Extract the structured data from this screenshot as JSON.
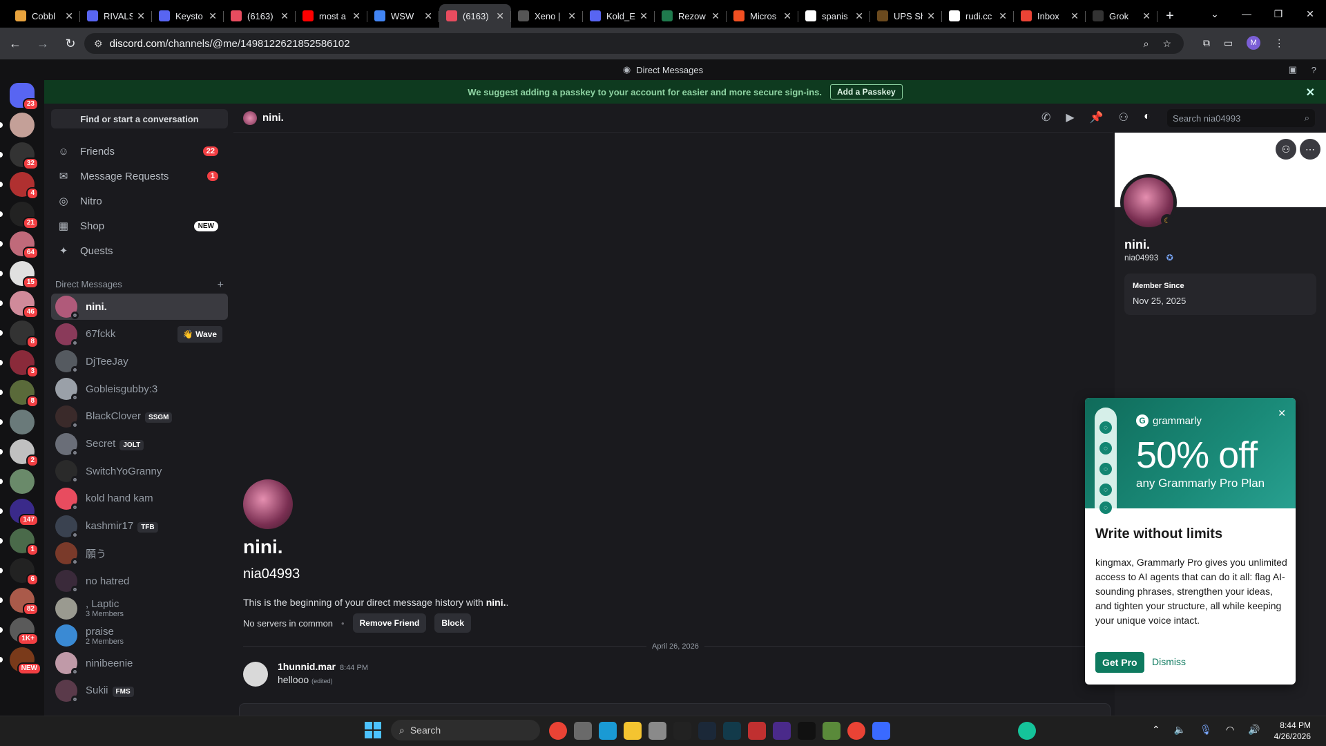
{
  "browser": {
    "tabs": [
      {
        "title": "Cobbl",
        "favcolor": "#e8a33d",
        "icon": "cobble-icon"
      },
      {
        "title": "RIVALS",
        "favcolor": "#5865f2",
        "icon": "discord-icon"
      },
      {
        "title": "Keysto",
        "favcolor": "#5865f2",
        "icon": "discord-icon"
      },
      {
        "title": "(6163)",
        "favcolor": "#e84c5f",
        "icon": "discord-icon"
      },
      {
        "title": "most a",
        "favcolor": "#ff0000",
        "icon": "youtube-icon"
      },
      {
        "title": "WSW",
        "favcolor": "#4285f4",
        "icon": "docs-icon"
      },
      {
        "title": "(6163)",
        "favcolor": "#e84c5f",
        "icon": "discord-icon"
      },
      {
        "title": "Xeno |",
        "favcolor": "#555555",
        "icon": "xeno-icon"
      },
      {
        "title": "Kold_E",
        "favcolor": "#5865f2",
        "icon": "discord-icon"
      },
      {
        "title": "Rezow",
        "favcolor": "#1f7a4d",
        "icon": "rezow-icon"
      },
      {
        "title": "Micros",
        "favcolor": "#f25022",
        "icon": "microsoft-icon"
      },
      {
        "title": "spanis",
        "favcolor": "#ffffff",
        "icon": "google-icon"
      },
      {
        "title": "UPS Sh",
        "favcolor": "#6b4a1e",
        "icon": "ups-icon"
      },
      {
        "title": "rudi.cc",
        "favcolor": "#ffffff",
        "icon": "google-icon"
      },
      {
        "title": "Inbox",
        "favcolor": "#ea4335",
        "icon": "gmail-icon"
      },
      {
        "title": "Grok",
        "favcolor": "#333333",
        "icon": "grok-icon"
      }
    ],
    "active_tab": 6,
    "url_domain": "discord.com",
    "url_path": "/channels/@me/1498122621852586102",
    "profile_letter": "M"
  },
  "discord": {
    "window_title": "Direct Messages",
    "banner": {
      "text": "We suggest adding a passkey to your account for easier and more secure sign-ins.",
      "button": "Add a Passkey"
    },
    "find_conversation": "Find or start a conversation",
    "nav": [
      {
        "label": "Friends",
        "icon": "friends-icon",
        "count": "22"
      },
      {
        "label": "Message Requests",
        "icon": "mail-icon",
        "count": "1"
      },
      {
        "label": "Nitro",
        "icon": "nitro-icon"
      },
      {
        "label": "Shop",
        "icon": "shop-icon",
        "badge": "NEW"
      },
      {
        "label": "Quests",
        "icon": "quests-icon"
      }
    ],
    "dm_header": "Direct Messages",
    "dms": [
      {
        "name": "nini.",
        "color": "#b05a7a",
        "selected": true
      },
      {
        "name": "67fckk",
        "color": "#8a3a5a",
        "action": "Wave"
      },
      {
        "name": "DjTeeJay",
        "color": "#555a60"
      },
      {
        "name": "Gobleisgubby:3",
        "color": "#9aa0a8"
      },
      {
        "name": "BlackClover",
        "color": "#3a2a2a",
        "tag": "SSGM"
      },
      {
        "name": "Secret",
        "color": "#6a6e78",
        "tag": "JOLT"
      },
      {
        "name": "SwitchYoGranny",
        "color": "#2a2a2a"
      },
      {
        "name": "kold hand kam",
        "color": "#e84c5f"
      },
      {
        "name": "kashmir17",
        "color": "#3a4250",
        "tag": "TFB"
      },
      {
        "name": "願う",
        "color": "#7a3a2a"
      },
      {
        "name": "no hatred",
        "color": "#3a2a3a"
      },
      {
        "name": ", Laptic",
        "color": "#9a9a90",
        "sub": "3 Members"
      },
      {
        "name": "praise",
        "color": "#3a8ad4",
        "sub": "2 Members"
      },
      {
        "name": "ninibeenie",
        "color": "#c09aa8"
      },
      {
        "name": "Sukii",
        "color": "#5a3a4a",
        "tag": "FMS"
      }
    ],
    "servers": [
      {
        "color": "#5865f2",
        "badge": "23"
      },
      {
        "color": "#c4a098"
      },
      {
        "color": "#333333",
        "badge": "32"
      },
      {
        "color": "#b03030",
        "badge": "4"
      },
      {
        "color": "#222222",
        "badge": "21"
      },
      {
        "color": "#c06a7a",
        "badge": "64"
      },
      {
        "color": "#e0e0e0",
        "badge": "15"
      },
      {
        "color": "#d08a9a",
        "badge": "46"
      },
      {
        "color": "#333333",
        "badge": "8"
      },
      {
        "color": "#8a2a3a",
        "badge": "3"
      },
      {
        "color": "#5a6a3a",
        "badge": "8"
      },
      {
        "color": "#6a7a7a"
      },
      {
        "color": "#c0c0c0",
        "badge": "2"
      },
      {
        "color": "#6a8a6a"
      },
      {
        "color": "#3a2a8a",
        "badge": "147"
      },
      {
        "color": "#4a6a4a",
        "badge": "1"
      },
      {
        "color": "#222222",
        "badge": "6"
      },
      {
        "color": "#aa5a4a",
        "badge": "82"
      },
      {
        "color": "#5a5a5a",
        "badge": "1K+"
      },
      {
        "color": "#7a3a1a",
        "badge": "NEW"
      }
    ],
    "chat": {
      "header_name": "nini.",
      "search_placeholder": "Search nia04993",
      "intro_name": "nini.",
      "intro_username": "nia04993",
      "intro_text": "This is the beginning of your direct message history with",
      "intro_bold": "nini.",
      "intro_end": ".",
      "no_servers": "No servers in common",
      "remove_friend": "Remove Friend",
      "block": "Block",
      "date": "April 26, 2026",
      "message": {
        "author": "1hunnid.mar",
        "time": "8:44 PM",
        "text": "hellooo",
        "edited": "(edited)"
      }
    },
    "profile": {
      "name": "nini.",
      "username": "nia04993",
      "member_since_label": "Member Since",
      "member_since": "Nov 25, 2025"
    }
  },
  "grammarly": {
    "brand": "grammarly",
    "offer": "50% off",
    "plan": "any Grammarly Pro Plan",
    "heading": "Write without limits",
    "body": "kingmax, Grammarly Pro gives you unlimited access to AI agents that can do it all: flag AI-sounding phrases, strengthen your ideas, and tighten your structure, all while keeping your unique voice intact.",
    "cta": "Get Pro",
    "dismiss": "Dismiss"
  },
  "taskbar": {
    "search_placeholder": "Search",
    "time": "8:44 PM",
    "date": "4/26/2026",
    "apps": [
      {
        "name": "chrome-icon",
        "color": "#ea4335"
      },
      {
        "name": "app-grey-icon",
        "color": "#6a6a6a"
      },
      {
        "name": "edge-icon",
        "color": "#1a9ad4"
      },
      {
        "name": "file-explorer-icon",
        "color": "#f4c430"
      },
      {
        "name": "settings-icon",
        "color": "#8a8a8a"
      },
      {
        "name": "app-red-icon",
        "color": "#222222"
      },
      {
        "name": "steam-icon",
        "color": "#1b2838"
      },
      {
        "name": "app-teal-icon",
        "color": "#123a4a"
      },
      {
        "name": "voicemod-icon",
        "color": "#c03030"
      },
      {
        "name": "next-icon",
        "color": "#4a2a8a"
      },
      {
        "name": "capcut-icon",
        "color": "#111111"
      },
      {
        "name": "minecraft-icon",
        "color": "#5a8a3a"
      },
      {
        "name": "chrome-profile-icon",
        "color": "#ea4335"
      },
      {
        "name": "roblox-icon",
        "color": "#3a6aff"
      },
      {
        "name": "grammarly-icon",
        "color": "#15c39a"
      }
    ]
  }
}
